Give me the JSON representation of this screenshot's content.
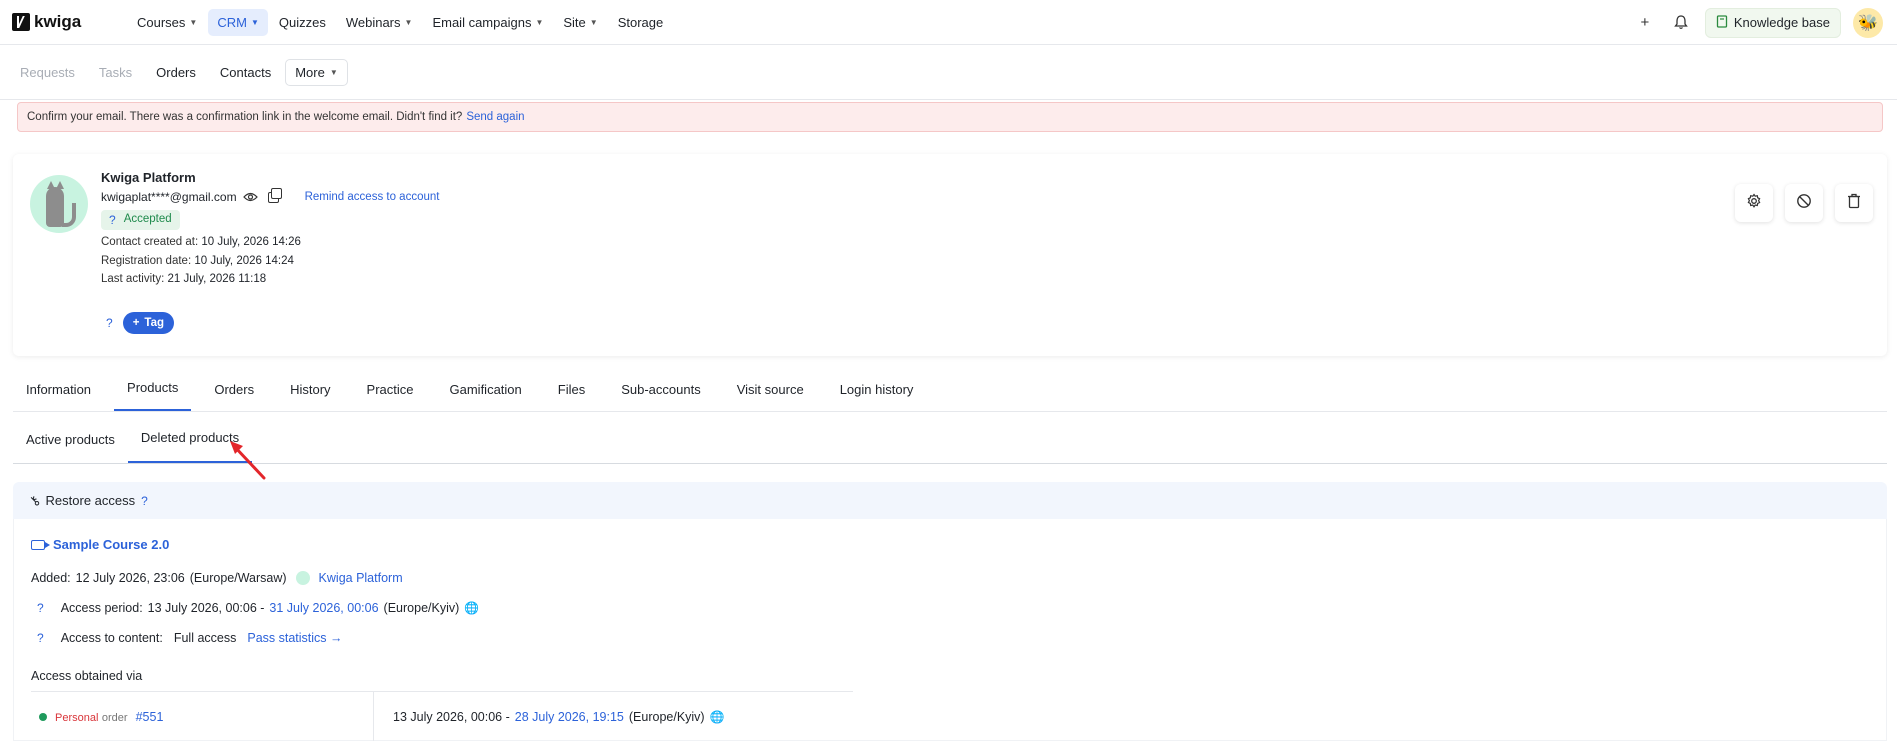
{
  "topbar": {
    "logo_text": "kwiga",
    "nav": [
      {
        "label": "Courses",
        "has_menu": true
      },
      {
        "label": "CRM",
        "has_menu": true,
        "active": true
      },
      {
        "label": "Quizzes",
        "has_menu": false
      },
      {
        "label": "Webinars",
        "has_menu": true
      },
      {
        "label": "Email campaigns",
        "has_menu": true
      },
      {
        "label": "Site",
        "has_menu": true
      },
      {
        "label": "Storage",
        "has_menu": false
      }
    ],
    "add_icon": "plus-icon",
    "notifications_icon": "bell-icon",
    "knowledge_base_label": "Knowledge base"
  },
  "subnav": {
    "items": [
      "Requests",
      "Tasks",
      "Orders",
      "Contacts"
    ],
    "more_label": "More"
  },
  "alert": {
    "text": "Confirm your email. There was a confirmation link in the welcome email. Didn't find it?",
    "link": "Send again"
  },
  "profile": {
    "name": "Kwiga Platform",
    "email": "kwigaplat****@gmail.com",
    "remind_link": "Remind access to account",
    "status_q": "?",
    "status": "Accepted",
    "created_label": "Contact created at:",
    "created_value": "10 July, 2026 14:26",
    "registered_label": "Registration date:",
    "registered_value": "10 July, 2026 14:24",
    "activity_label": "Last activity:",
    "activity_value": "21 July, 2026 11:18",
    "tag_q": "?",
    "tag_button": "Tag"
  },
  "tabs": [
    "Information",
    "Products",
    "Orders",
    "History",
    "Practice",
    "Gamification",
    "Files",
    "Sub-accounts",
    "Visit source",
    "Login history"
  ],
  "active_tab": "Products",
  "subtabs": [
    "Active products",
    "Deleted products"
  ],
  "active_subtab": "Deleted products",
  "restore": {
    "label": "Restore access",
    "q": "?"
  },
  "product": {
    "course_name": "Sample Course 2.0",
    "added_label": "Added:",
    "added_value": "12 July 2026, 23:06",
    "added_tz": "(Europe/Warsaw)",
    "added_by": "Kwiga Platform",
    "access_period_label": "Access period:",
    "access_period_start": "13 July 2026, 00:06 -",
    "access_period_end": "31 July 2026, 00:06",
    "access_period_tz": "(Europe/Kyiv)",
    "content_label": "Access to content:",
    "content_value": "Full access",
    "pass_stats": "Pass statistics →",
    "obtained_label": "Access obtained via",
    "order_type": "Personal",
    "order_word": "order",
    "order_number": "#551",
    "order_start": "13 July 2026, 00:06 -",
    "order_end": "28 July 2026, 19:15",
    "order_tz": "(Europe/Kyiv)",
    "q": "?"
  }
}
